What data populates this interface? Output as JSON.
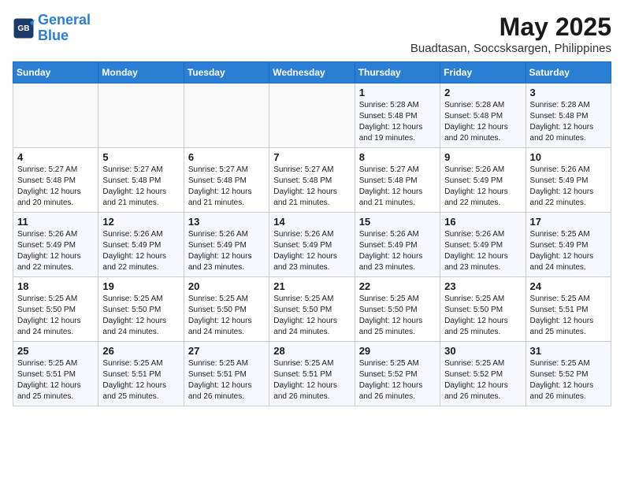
{
  "header": {
    "logo_line1": "General",
    "logo_line2": "Blue",
    "month_year": "May 2025",
    "location": "Buadtasan, Soccsksargen, Philippines"
  },
  "days_of_week": [
    "Sunday",
    "Monday",
    "Tuesday",
    "Wednesday",
    "Thursday",
    "Friday",
    "Saturday"
  ],
  "weeks": [
    [
      {
        "day": "",
        "info": ""
      },
      {
        "day": "",
        "info": ""
      },
      {
        "day": "",
        "info": ""
      },
      {
        "day": "",
        "info": ""
      },
      {
        "day": "1",
        "info": "Sunrise: 5:28 AM\nSunset: 5:48 PM\nDaylight: 12 hours\nand 19 minutes."
      },
      {
        "day": "2",
        "info": "Sunrise: 5:28 AM\nSunset: 5:48 PM\nDaylight: 12 hours\nand 20 minutes."
      },
      {
        "day": "3",
        "info": "Sunrise: 5:28 AM\nSunset: 5:48 PM\nDaylight: 12 hours\nand 20 minutes."
      }
    ],
    [
      {
        "day": "4",
        "info": "Sunrise: 5:27 AM\nSunset: 5:48 PM\nDaylight: 12 hours\nand 20 minutes."
      },
      {
        "day": "5",
        "info": "Sunrise: 5:27 AM\nSunset: 5:48 PM\nDaylight: 12 hours\nand 21 minutes."
      },
      {
        "day": "6",
        "info": "Sunrise: 5:27 AM\nSunset: 5:48 PM\nDaylight: 12 hours\nand 21 minutes."
      },
      {
        "day": "7",
        "info": "Sunrise: 5:27 AM\nSunset: 5:48 PM\nDaylight: 12 hours\nand 21 minutes."
      },
      {
        "day": "8",
        "info": "Sunrise: 5:27 AM\nSunset: 5:48 PM\nDaylight: 12 hours\nand 21 minutes."
      },
      {
        "day": "9",
        "info": "Sunrise: 5:26 AM\nSunset: 5:49 PM\nDaylight: 12 hours\nand 22 minutes."
      },
      {
        "day": "10",
        "info": "Sunrise: 5:26 AM\nSunset: 5:49 PM\nDaylight: 12 hours\nand 22 minutes."
      }
    ],
    [
      {
        "day": "11",
        "info": "Sunrise: 5:26 AM\nSunset: 5:49 PM\nDaylight: 12 hours\nand 22 minutes."
      },
      {
        "day": "12",
        "info": "Sunrise: 5:26 AM\nSunset: 5:49 PM\nDaylight: 12 hours\nand 22 minutes."
      },
      {
        "day": "13",
        "info": "Sunrise: 5:26 AM\nSunset: 5:49 PM\nDaylight: 12 hours\nand 23 minutes."
      },
      {
        "day": "14",
        "info": "Sunrise: 5:26 AM\nSunset: 5:49 PM\nDaylight: 12 hours\nand 23 minutes."
      },
      {
        "day": "15",
        "info": "Sunrise: 5:26 AM\nSunset: 5:49 PM\nDaylight: 12 hours\nand 23 minutes."
      },
      {
        "day": "16",
        "info": "Sunrise: 5:26 AM\nSunset: 5:49 PM\nDaylight: 12 hours\nand 23 minutes."
      },
      {
        "day": "17",
        "info": "Sunrise: 5:25 AM\nSunset: 5:49 PM\nDaylight: 12 hours\nand 24 minutes."
      }
    ],
    [
      {
        "day": "18",
        "info": "Sunrise: 5:25 AM\nSunset: 5:50 PM\nDaylight: 12 hours\nand 24 minutes."
      },
      {
        "day": "19",
        "info": "Sunrise: 5:25 AM\nSunset: 5:50 PM\nDaylight: 12 hours\nand 24 minutes."
      },
      {
        "day": "20",
        "info": "Sunrise: 5:25 AM\nSunset: 5:50 PM\nDaylight: 12 hours\nand 24 minutes."
      },
      {
        "day": "21",
        "info": "Sunrise: 5:25 AM\nSunset: 5:50 PM\nDaylight: 12 hours\nand 24 minutes."
      },
      {
        "day": "22",
        "info": "Sunrise: 5:25 AM\nSunset: 5:50 PM\nDaylight: 12 hours\nand 25 minutes."
      },
      {
        "day": "23",
        "info": "Sunrise: 5:25 AM\nSunset: 5:50 PM\nDaylight: 12 hours\nand 25 minutes."
      },
      {
        "day": "24",
        "info": "Sunrise: 5:25 AM\nSunset: 5:51 PM\nDaylight: 12 hours\nand 25 minutes."
      }
    ],
    [
      {
        "day": "25",
        "info": "Sunrise: 5:25 AM\nSunset: 5:51 PM\nDaylight: 12 hours\nand 25 minutes."
      },
      {
        "day": "26",
        "info": "Sunrise: 5:25 AM\nSunset: 5:51 PM\nDaylight: 12 hours\nand 25 minutes."
      },
      {
        "day": "27",
        "info": "Sunrise: 5:25 AM\nSunset: 5:51 PM\nDaylight: 12 hours\nand 26 minutes."
      },
      {
        "day": "28",
        "info": "Sunrise: 5:25 AM\nSunset: 5:51 PM\nDaylight: 12 hours\nand 26 minutes."
      },
      {
        "day": "29",
        "info": "Sunrise: 5:25 AM\nSunset: 5:52 PM\nDaylight: 12 hours\nand 26 minutes."
      },
      {
        "day": "30",
        "info": "Sunrise: 5:25 AM\nSunset: 5:52 PM\nDaylight: 12 hours\nand 26 minutes."
      },
      {
        "day": "31",
        "info": "Sunrise: 5:25 AM\nSunset: 5:52 PM\nDaylight: 12 hours\nand 26 minutes."
      }
    ]
  ]
}
